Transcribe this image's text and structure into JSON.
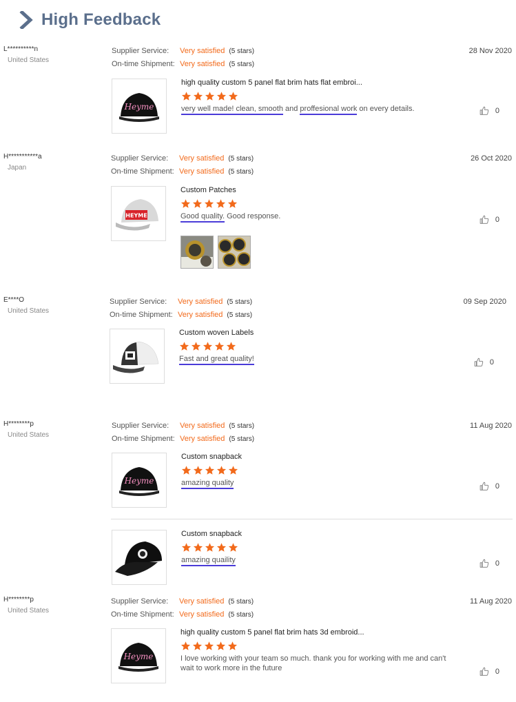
{
  "header": {
    "title": "High Feedback"
  },
  "labels": {
    "supplier_service": "Supplier Service:",
    "ontime_shipment": "On-time Shipment:",
    "very_satisfied": "Very satisfied",
    "five_stars": "(5 stars)"
  },
  "colors": {
    "accent": "#f26a1b",
    "header": "#5b6f8c",
    "underline": "#4a3bd8"
  },
  "reviews": [
    {
      "user": "L**********n",
      "country": "United States",
      "date": "28 Nov 2020",
      "product_title": "high quality custom 5 panel flat brim hats flat embroi...",
      "rating": 5,
      "comment_a": "very well made! clean, smooth",
      "comment_b": " and ",
      "comment_c": "proffesional work",
      "comment_d": " on every details.",
      "likes": "0"
    },
    {
      "user": "H***********a",
      "country": "Japan",
      "date": "26 Oct 2020",
      "product_title": "Custom Patches",
      "rating": 5,
      "comment_a": "Good quality.",
      "comment_b": " Good response.",
      "likes": "0"
    },
    {
      "user": "E****O",
      "country": "United States",
      "date": "09 Sep 2020",
      "product_title": "Custom woven Labels",
      "rating": 5,
      "comment_a": "Fast and great quality!",
      "likes": "0"
    },
    {
      "user": "H********p",
      "country": "United States",
      "date": "11 Aug 2020",
      "product_title": "Custom snapback",
      "rating": 5,
      "comment_a": "amazing quality",
      "likes": "0",
      "product2_title": "Custom snapback",
      "comment2_a": "amazing quaility",
      "likes2": "0"
    },
    {
      "user": "H********p",
      "country": "United States",
      "date": "11 Aug 2020",
      "product_title": "high quality custom 5 panel flat brim hats 3d embroid...",
      "rating": 5,
      "comment_a": "I love working with your team so much.  thank you for working with me and can't",
      "comment_b": " wait to work more in the future",
      "likes": "0"
    }
  ],
  "images": {
    "black_hat_heyme_script": "Heyme",
    "grey_hat_patch": "HEYME"
  }
}
